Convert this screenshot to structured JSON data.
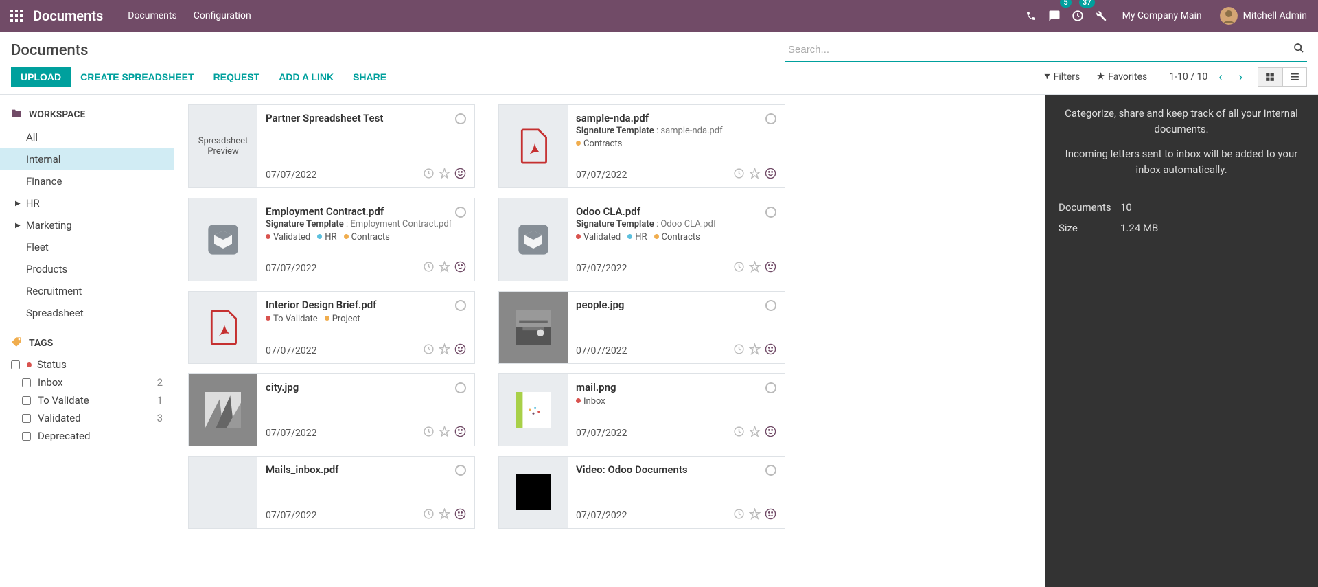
{
  "header": {
    "brand": "Documents",
    "nav": [
      "Documents",
      "Configuration"
    ],
    "chat_count": "5",
    "clock_count": "37",
    "company": "My Company Main",
    "user": "Mitchell Admin"
  },
  "breadcrumb": {
    "title": "Documents"
  },
  "search": {
    "placeholder": "Search..."
  },
  "toolbar": {
    "upload": "UPLOAD",
    "create_sheet": "CREATE SPREADSHEET",
    "request": "REQUEST",
    "add_link": "ADD A LINK",
    "share": "SHARE",
    "filters": "Filters",
    "favorites": "Favorites",
    "pager": "1-10 / 10"
  },
  "sidebar": {
    "workspace_label": "WORKSPACE",
    "items": [
      {
        "label": "All"
      },
      {
        "label": "Internal",
        "selected": true
      },
      {
        "label": "Finance"
      },
      {
        "label": "HR",
        "arrow": true
      },
      {
        "label": "Marketing",
        "arrow": true
      },
      {
        "label": "Fleet"
      },
      {
        "label": "Products"
      },
      {
        "label": "Recruitment"
      },
      {
        "label": "Spreadsheet"
      }
    ],
    "tags_label": "TAGS",
    "tags": [
      {
        "label": "Status",
        "dot": "d-red"
      },
      {
        "label": "Inbox",
        "count": "2",
        "indent": true
      },
      {
        "label": "To Validate",
        "count": "1",
        "indent": true
      },
      {
        "label": "Validated",
        "count": "3",
        "indent": true
      },
      {
        "label": "Deprecated",
        "indent": true
      }
    ]
  },
  "cards": [
    {
      "title": "Partner Spreadsheet Test",
      "date": "07/07/2022",
      "thumb": "sheet_preview",
      "tags": [],
      "height": "normal"
    },
    {
      "title": "sample-nda.pdf",
      "sub_label": "Signature Template",
      "sub_val": "sample-nda.pdf",
      "date": "07/07/2022",
      "thumb": "pdf",
      "tags": [
        {
          "d": "d-yellow",
          "t": "Contracts"
        }
      ],
      "height": "normal"
    },
    {
      "title": "Employment Contract.pdf",
      "sub_label": "Signature Template",
      "sub_val": "Employment Contract.pdf",
      "date": "07/07/2022",
      "thumb": "box",
      "tags": [
        {
          "d": "d-red",
          "t": "Validated"
        },
        {
          "d": "d-blue",
          "t": "HR"
        },
        {
          "d": "d-yellow",
          "t": "Contracts"
        }
      ],
      "height": "normal"
    },
    {
      "title": "Odoo CLA.pdf",
      "sub_label": "Signature Template",
      "sub_val": "Odoo CLA.pdf",
      "date": "07/07/2022",
      "thumb": "box",
      "tags": [
        {
          "d": "d-red",
          "t": "Validated"
        },
        {
          "d": "d-blue",
          "t": "HR"
        },
        {
          "d": "d-yellow",
          "t": "Contracts"
        }
      ],
      "height": "normal"
    },
    {
      "title": "Interior Design Brief.pdf",
      "date": "07/07/2022",
      "thumb": "pdf",
      "tags": [
        {
          "d": "d-red",
          "t": "To Validate"
        },
        {
          "d": "d-yellow",
          "t": "Project"
        }
      ],
      "height": "small"
    },
    {
      "title": "people.jpg",
      "date": "07/07/2022",
      "thumb": "photo_people",
      "tags": [],
      "height": "small"
    },
    {
      "title": "city.jpg",
      "date": "07/07/2022",
      "thumb": "photo_city",
      "tags": [],
      "height": "small"
    },
    {
      "title": "mail.png",
      "date": "07/07/2022",
      "thumb": "mail",
      "tags": [
        {
          "d": "d-red",
          "t": "Inbox"
        }
      ],
      "height": "small"
    },
    {
      "title": "Mails_inbox.pdf",
      "date": "07/07/2022",
      "thumb": "blank",
      "tags": [],
      "height": "small"
    },
    {
      "title": "Video: Odoo Documents",
      "date": "07/07/2022",
      "thumb": "video",
      "tags": [],
      "height": "small"
    }
  ],
  "rightpanel": {
    "line1": "Categorize, share and keep track of all your internal documents.",
    "line2": "Incoming letters sent to inbox will be added to your inbox automatically.",
    "stats": {
      "docs_label": "Documents",
      "docs_val": "10",
      "size_label": "Size",
      "size_val": "1.24 MB"
    }
  }
}
